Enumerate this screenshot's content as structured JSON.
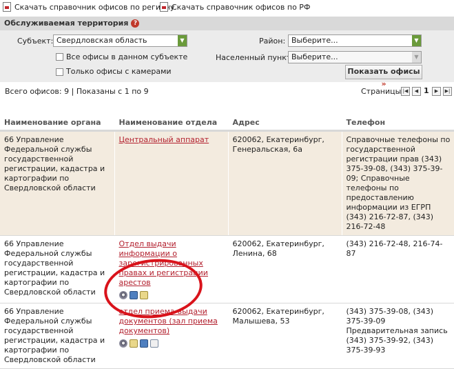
{
  "downloads": {
    "by_region": "Скачать справочник офисов по региону",
    "by_country": "Скачать справочник офисов по РФ"
  },
  "filter": {
    "title": "Обслуживаемая территория",
    "help": "?",
    "subject_label": "Субъект:",
    "subject_value": "Свердловская область",
    "district_label": "Район:",
    "district_value": "Выберите...",
    "locality_label": "Населенный пункт:",
    "locality_value": "Выберите...",
    "all_offices_label": "Все офисы в данном субъекте",
    "camera_offices_label": "Только офисы с камерами",
    "show_button": "Показать офисы",
    "show_button_mark": "»"
  },
  "summary": {
    "text": "Всего офисов: 9 | Показаны с 1 по 9",
    "pages_label": "Страницы:",
    "current_page": "1"
  },
  "table": {
    "headers": [
      "Наименование органа",
      "Наименование отдела",
      "Адрес",
      "Телефон"
    ],
    "rows": [
      {
        "organ": "66 Управление Федеральной службы государственной регистрации, кадастра и картографии по Свердловской области",
        "department": "Центральный аппарат",
        "address": "620062, Екатеринбург, Генеральская, 6а",
        "phone": "Справочные телефоны по государственной регистрации прав (343) 375-39-08, (343) 375-39-09; Справочные телефоны по предоставлению информации из ЕГРП (343) 216-72-87, (343) 216-72-48"
      },
      {
        "organ": "66 Управление Федеральной службы государственной регистрации, кадастра и картографии по Свердловской области",
        "department": "Отдел выдачи информации о зарегистрированных правах и регистрации арестов",
        "address": "620062, Екатеринбург, Ленина, 68",
        "phone": "(343) 216-72-48, 216-74-87"
      },
      {
        "organ": "66 Управление Федеральной службы государственной регистрации, кадастра и картографии по Свердловской области",
        "department": "отдел приема-выдачи документов (зал приема документов)",
        "address": "620062, Екатеринбург, Малышева, 53",
        "phone": "(343) 375-39-08, (343) 375-39-09 Предварительная запись (343) 375-39-92, (343) 375-39-93"
      }
    ]
  }
}
